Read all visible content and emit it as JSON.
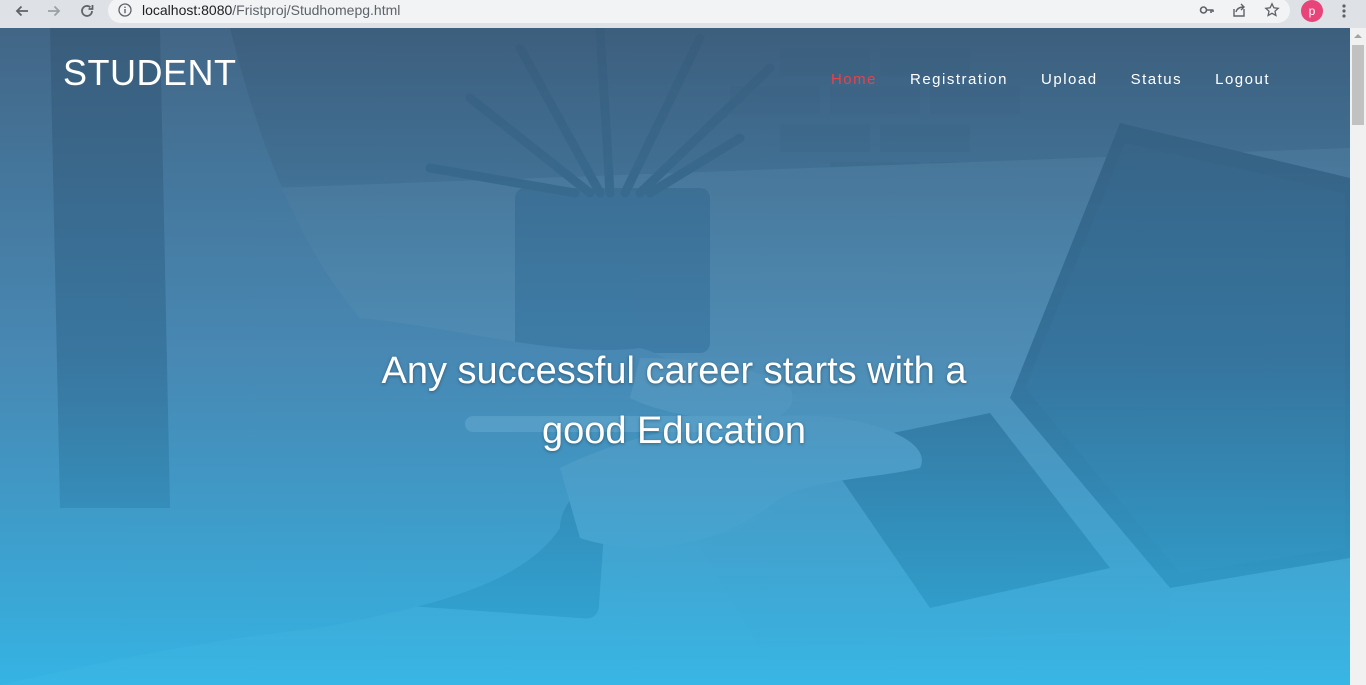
{
  "browser": {
    "url_host": "localhost:8080",
    "url_path": "/Fristproj/Studhomepg.html",
    "profile_initial": "p",
    "profile_color": "#e8447a",
    "icons": [
      "back-icon",
      "forward-icon",
      "reload-icon",
      "info-icon",
      "key-icon",
      "share-icon",
      "star-icon",
      "more-vert-icon"
    ]
  },
  "site": {
    "brand": "STUDENT",
    "nav": [
      {
        "label": "Home",
        "active": true
      },
      {
        "label": "Registration",
        "active": false
      },
      {
        "label": "Upload",
        "active": false
      },
      {
        "label": "Status",
        "active": false
      },
      {
        "label": "Logout",
        "active": false
      }
    ],
    "headline_line1": "Any successful career starts with a",
    "headline_line2": "good Education",
    "colors": {
      "active_nav": "#e8414a",
      "overlay_top": "#3b5f80",
      "overlay_bottom": "#2fb6e8"
    }
  }
}
